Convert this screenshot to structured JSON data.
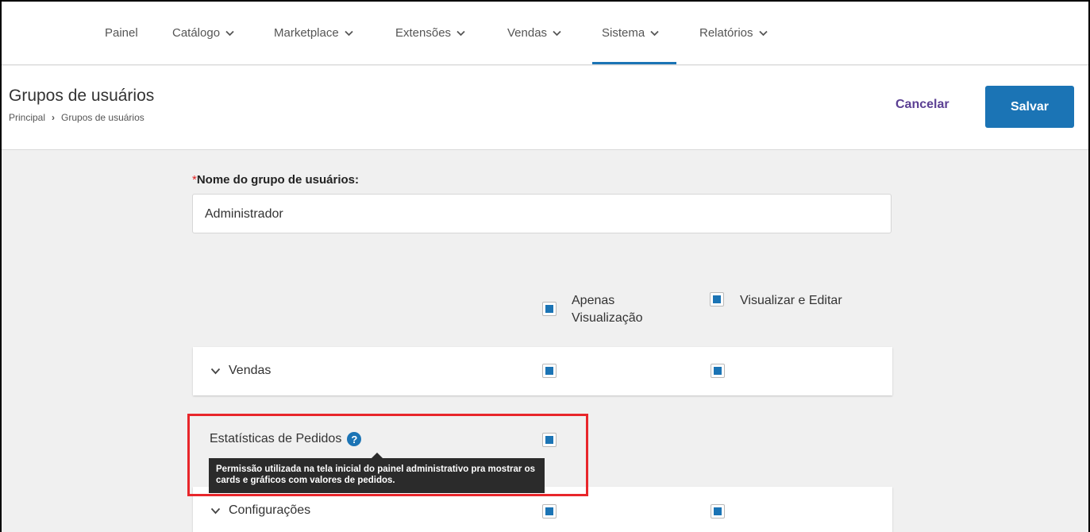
{
  "nav": {
    "items": [
      {
        "label": "Painel",
        "has_dropdown": false
      },
      {
        "label": "Catálogo",
        "has_dropdown": true
      },
      {
        "label": "Marketplace",
        "has_dropdown": true
      },
      {
        "label": "Extensões",
        "has_dropdown": true
      },
      {
        "label": "Vendas",
        "has_dropdown": true
      },
      {
        "label": "Sistema",
        "has_dropdown": true,
        "active": true
      },
      {
        "label": "Relatórios",
        "has_dropdown": true
      }
    ]
  },
  "header": {
    "title": "Grupos de usuários",
    "breadcrumb": [
      "Principal",
      "Grupos de usuários"
    ],
    "breadcrumb_separator": "›",
    "cancel_label": "Cancelar",
    "save_label": "Salvar"
  },
  "form": {
    "required_marker": "*",
    "name_label": "Nome do grupo de usuários:",
    "name_value": "Administrador",
    "columns": {
      "view_only": "Apenas Visualização",
      "view_edit": "Visualizar e Editar"
    },
    "sections": [
      {
        "label": "Vendas",
        "view_only": true,
        "view_edit": true
      },
      {
        "label": "Configurações",
        "view_only": true,
        "view_edit": true
      }
    ],
    "permission": {
      "label": "Estatísticas de Pedidos",
      "view_only": true,
      "tooltip": "Permissão utilizada na tela inicial do painel administrativo pra mostrar os cards e gráficos com valores de pedidos.",
      "help_icon_glyph": "?"
    }
  },
  "colors": {
    "accent": "#1b74b5",
    "cancel": "#5b3f93",
    "highlight": "#e8262b",
    "required": "#e02020"
  }
}
